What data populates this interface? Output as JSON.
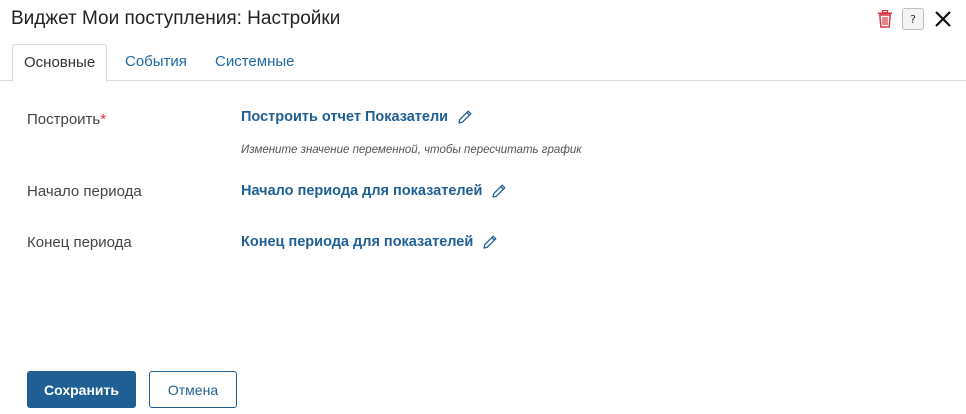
{
  "dialog": {
    "title": "Виджет Мои поступления: Настройки",
    "actions": {
      "delete_icon": "trash-icon",
      "help_icon": "help-icon",
      "help_glyph": "?",
      "close_icon": "close-icon"
    }
  },
  "tabs": [
    {
      "label": "Основные",
      "active": true
    },
    {
      "label": "События",
      "active": false
    },
    {
      "label": "Системные",
      "active": false
    }
  ],
  "fields": [
    {
      "label": "Построить",
      "required_mark": "*",
      "value": "Построить отчет Показатели",
      "hint": "Измените значение переменной, чтобы пересчитать график",
      "edit_icon": "pencil-icon"
    },
    {
      "label": "Начало периода",
      "value": "Начало периода для показателей",
      "edit_icon": "pencil-icon"
    },
    {
      "label": "Конец периода",
      "value": "Конец периода для показателей",
      "edit_icon": "pencil-icon"
    }
  ],
  "footer": {
    "save_label": "Сохранить",
    "cancel_label": "Отмена"
  },
  "colors": {
    "accent": "#1f5f94",
    "link": "#1f6aa5",
    "required": "#d9303e",
    "delete": "#d9303e"
  }
}
